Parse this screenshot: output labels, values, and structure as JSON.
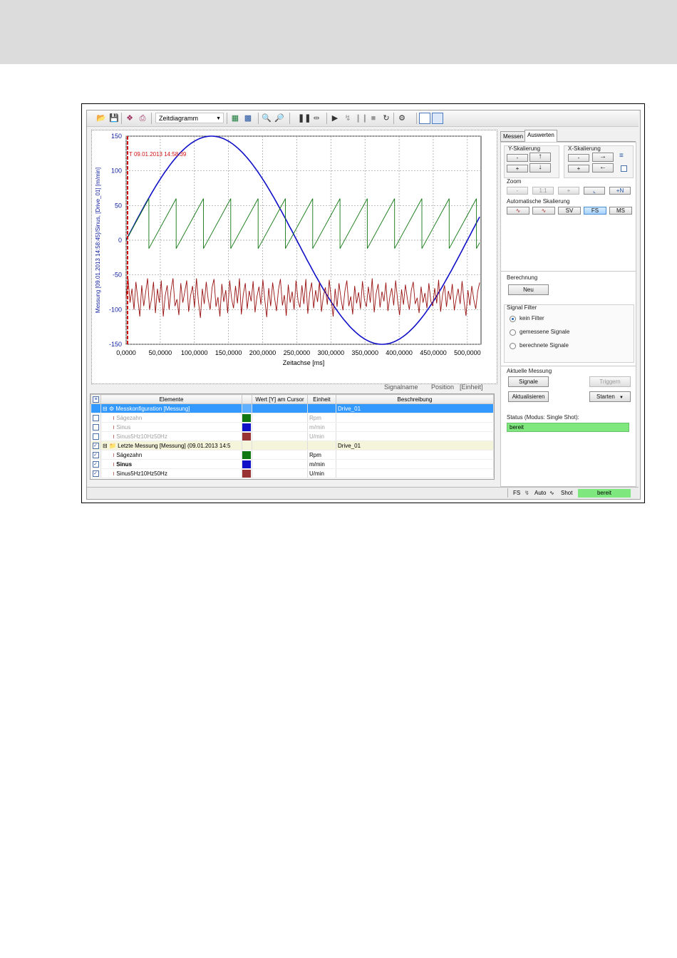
{
  "toolbar": {
    "diagram_type": "Zeitdiagramm"
  },
  "chart_data": {
    "type": "line",
    "xlabel": "Zeitachse [ms]",
    "ylabel": "Messung [09.01.2013 14:58:45]/Sinus, [Drive_01] [m/min]",
    "xlim": [
      0,
      520
    ],
    "ylim": [
      -150,
      150
    ],
    "x_ticks": [
      "0,0000",
      "50,0000",
      "100,0000",
      "150,0000",
      "200,0000",
      "250,0000",
      "300,0000",
      "350,0000",
      "400,0000",
      "450,0000",
      "500,0000"
    ],
    "y_ticks": [
      "150",
      "100",
      "50",
      "0",
      "-50",
      "-100",
      "-150"
    ],
    "cursor": {
      "x": 0,
      "label": "T 09.01.2013 14:58:39"
    },
    "series": [
      {
        "color": "#1010c8",
        "kind": "sine",
        "amplitude": 150,
        "period_ms": 500,
        "x_end": 518
      },
      {
        "color": "#117711",
        "kind": "sawtooth",
        "low": -12,
        "high": 60,
        "period_ms": 40,
        "x_end": 518
      },
      {
        "color": "#991111",
        "kind": "noise",
        "mean": -83,
        "x_end": 518,
        "values": [
          -83,
          -55,
          -90,
          -70,
          -100,
          -60,
          -85,
          -110,
          -65,
          -95,
          -75,
          -55,
          -100,
          -85,
          -60,
          -105,
          -70,
          -90,
          -58,
          -110,
          -80,
          -65,
          -100,
          -72,
          -55,
          -95,
          -85,
          -108,
          -62,
          -90,
          -75,
          -58,
          -103,
          -80,
          -66,
          -97,
          -55,
          -88,
          -112,
          -70,
          -92,
          -60,
          -85,
          -100,
          -68,
          -56,
          -96,
          -82,
          -110,
          -63,
          -89,
          -72,
          -105,
          -58,
          -84,
          -98,
          -66,
          -91,
          -55,
          -107,
          -78,
          -62,
          -99,
          -73,
          -88,
          -59,
          -104,
          -81,
          -67,
          -93,
          -57,
          -86,
          -111,
          -69,
          -95,
          -61,
          -83,
          -102,
          -71,
          -56,
          -94,
          -79,
          -109,
          -64,
          -90,
          -74,
          -100,
          -58,
          -87,
          -97,
          -65,
          -92,
          -56,
          -106,
          -76,
          -61,
          -98,
          -72,
          -89,
          -60,
          -103,
          -80,
          -68,
          -93,
          -57,
          -85,
          -110,
          -70,
          -96,
          -62,
          -84,
          -101,
          -73,
          -58,
          -95,
          -81,
          -107,
          -66,
          -91,
          -75,
          -99,
          -59,
          -86,
          -96,
          -67,
          -90,
          -55,
          -104,
          -77,
          -63,
          -97,
          -74,
          -88,
          -61,
          -102,
          -82,
          -69,
          -94,
          -58,
          -87,
          -108,
          -71,
          -93,
          -64,
          -85,
          -100,
          -72,
          -60,
          -92,
          -83,
          -105,
          -67,
          -90,
          -76,
          -98,
          -62,
          -88,
          -95,
          -69,
          -91,
          -57,
          -103,
          -79,
          -65,
          -96,
          -73,
          -86,
          -63,
          -101,
          -84,
          -70,
          -92,
          -59,
          -88,
          -109,
          -72,
          -94,
          -66,
          -86,
          -99,
          -74,
          -61
        ]
      }
    ]
  },
  "signal_info": {
    "name": "Signalname",
    "position": "Position",
    "unit": "[Einheit]"
  },
  "grid": {
    "headers": [
      "Elemente",
      "Wert [Y] am Cursor",
      "Einheit",
      "Beschreibung"
    ],
    "rows": [
      {
        "type": "config",
        "checked": false,
        "label": "Messkonfiguration [Messung]",
        "color": "",
        "unit": "",
        "desc": "Drive_01"
      },
      {
        "type": "signal-dim",
        "checked": false,
        "label": "Sägezahn",
        "color": "#117711",
        "unit": "Rpm",
        "desc": ""
      },
      {
        "type": "signal-dim",
        "checked": false,
        "label": "Sinus",
        "color": "#1010c8",
        "unit": "m/min",
        "desc": ""
      },
      {
        "type": "signal-dim",
        "checked": false,
        "label": "Sinus5Hz10Hz50Hz",
        "color": "#993333",
        "unit": "U/min",
        "desc": ""
      },
      {
        "type": "measurement",
        "checked": true,
        "label": "Letzte Messung [Messung] (09.01.2013 14:5",
        "color": "",
        "unit": "",
        "desc": "Drive_01"
      },
      {
        "type": "signal",
        "checked": true,
        "label": "Sägezahn",
        "color": "#117711",
        "unit": "Rpm",
        "desc": ""
      },
      {
        "type": "signal-bold",
        "checked": true,
        "label": "Sinus",
        "color": "#1010c8",
        "unit": "m/min",
        "desc": ""
      },
      {
        "type": "signal",
        "checked": true,
        "label": "Sinus5Hz10Hz50Hz",
        "color": "#993333",
        "unit": "U/min",
        "desc": ""
      }
    ]
  },
  "right": {
    "tabs": [
      "Messen",
      "Auswerten"
    ],
    "y_scaling": "Y-Skalierung",
    "x_scaling": "X-Skalierung",
    "zoom": "Zoom",
    "zoom_buttons": [
      "-",
      "1:1",
      "+"
    ],
    "auto_scaling": "Automatische Skalierung",
    "auto_buttons": [
      "SV",
      "FS",
      "MS"
    ],
    "calc": "Berechnung",
    "new_btn": "Neu",
    "filter": "Signal Filter",
    "filter_opts": [
      "kein Filter",
      "gemessene Signale",
      "berechnete Signale"
    ],
    "current": "Aktuelle Messung",
    "signals_btn": "Signale",
    "trigger_btn": "Triggern",
    "refresh_btn": "Aktualisieren",
    "start_btn": "Starten",
    "status_label": "Status (Modus: Single Shot):",
    "status_value": "bereit"
  },
  "statusbar": {
    "fs": "FS",
    "auto": "Auto",
    "shot": "Shot",
    "state": "bereit"
  }
}
